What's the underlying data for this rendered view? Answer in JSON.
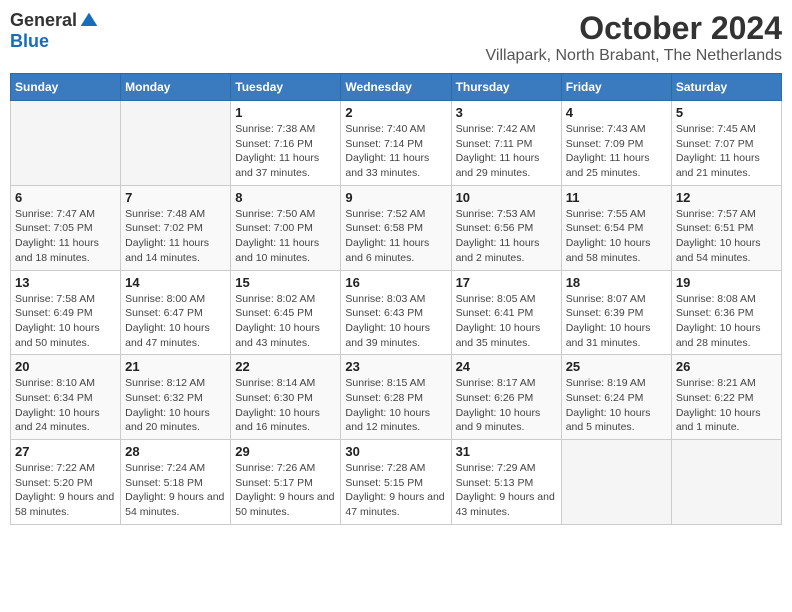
{
  "header": {
    "logo_general": "General",
    "logo_blue": "Blue",
    "month_title": "October 2024",
    "location": "Villapark, North Brabant, The Netherlands"
  },
  "days_of_week": [
    "Sunday",
    "Monday",
    "Tuesday",
    "Wednesday",
    "Thursday",
    "Friday",
    "Saturday"
  ],
  "weeks": [
    [
      {
        "day": "",
        "info": ""
      },
      {
        "day": "",
        "info": ""
      },
      {
        "day": "1",
        "info": "Sunrise: 7:38 AM\nSunset: 7:16 PM\nDaylight: 11 hours and 37 minutes."
      },
      {
        "day": "2",
        "info": "Sunrise: 7:40 AM\nSunset: 7:14 PM\nDaylight: 11 hours and 33 minutes."
      },
      {
        "day": "3",
        "info": "Sunrise: 7:42 AM\nSunset: 7:11 PM\nDaylight: 11 hours and 29 minutes."
      },
      {
        "day": "4",
        "info": "Sunrise: 7:43 AM\nSunset: 7:09 PM\nDaylight: 11 hours and 25 minutes."
      },
      {
        "day": "5",
        "info": "Sunrise: 7:45 AM\nSunset: 7:07 PM\nDaylight: 11 hours and 21 minutes."
      }
    ],
    [
      {
        "day": "6",
        "info": "Sunrise: 7:47 AM\nSunset: 7:05 PM\nDaylight: 11 hours and 18 minutes."
      },
      {
        "day": "7",
        "info": "Sunrise: 7:48 AM\nSunset: 7:02 PM\nDaylight: 11 hours and 14 minutes."
      },
      {
        "day": "8",
        "info": "Sunrise: 7:50 AM\nSunset: 7:00 PM\nDaylight: 11 hours and 10 minutes."
      },
      {
        "day": "9",
        "info": "Sunrise: 7:52 AM\nSunset: 6:58 PM\nDaylight: 11 hours and 6 minutes."
      },
      {
        "day": "10",
        "info": "Sunrise: 7:53 AM\nSunset: 6:56 PM\nDaylight: 11 hours and 2 minutes."
      },
      {
        "day": "11",
        "info": "Sunrise: 7:55 AM\nSunset: 6:54 PM\nDaylight: 10 hours and 58 minutes."
      },
      {
        "day": "12",
        "info": "Sunrise: 7:57 AM\nSunset: 6:51 PM\nDaylight: 10 hours and 54 minutes."
      }
    ],
    [
      {
        "day": "13",
        "info": "Sunrise: 7:58 AM\nSunset: 6:49 PM\nDaylight: 10 hours and 50 minutes."
      },
      {
        "day": "14",
        "info": "Sunrise: 8:00 AM\nSunset: 6:47 PM\nDaylight: 10 hours and 47 minutes."
      },
      {
        "day": "15",
        "info": "Sunrise: 8:02 AM\nSunset: 6:45 PM\nDaylight: 10 hours and 43 minutes."
      },
      {
        "day": "16",
        "info": "Sunrise: 8:03 AM\nSunset: 6:43 PM\nDaylight: 10 hours and 39 minutes."
      },
      {
        "day": "17",
        "info": "Sunrise: 8:05 AM\nSunset: 6:41 PM\nDaylight: 10 hours and 35 minutes."
      },
      {
        "day": "18",
        "info": "Sunrise: 8:07 AM\nSunset: 6:39 PM\nDaylight: 10 hours and 31 minutes."
      },
      {
        "day": "19",
        "info": "Sunrise: 8:08 AM\nSunset: 6:36 PM\nDaylight: 10 hours and 28 minutes."
      }
    ],
    [
      {
        "day": "20",
        "info": "Sunrise: 8:10 AM\nSunset: 6:34 PM\nDaylight: 10 hours and 24 minutes."
      },
      {
        "day": "21",
        "info": "Sunrise: 8:12 AM\nSunset: 6:32 PM\nDaylight: 10 hours and 20 minutes."
      },
      {
        "day": "22",
        "info": "Sunrise: 8:14 AM\nSunset: 6:30 PM\nDaylight: 10 hours and 16 minutes."
      },
      {
        "day": "23",
        "info": "Sunrise: 8:15 AM\nSunset: 6:28 PM\nDaylight: 10 hours and 12 minutes."
      },
      {
        "day": "24",
        "info": "Sunrise: 8:17 AM\nSunset: 6:26 PM\nDaylight: 10 hours and 9 minutes."
      },
      {
        "day": "25",
        "info": "Sunrise: 8:19 AM\nSunset: 6:24 PM\nDaylight: 10 hours and 5 minutes."
      },
      {
        "day": "26",
        "info": "Sunrise: 8:21 AM\nSunset: 6:22 PM\nDaylight: 10 hours and 1 minute."
      }
    ],
    [
      {
        "day": "27",
        "info": "Sunrise: 7:22 AM\nSunset: 5:20 PM\nDaylight: 9 hours and 58 minutes."
      },
      {
        "day": "28",
        "info": "Sunrise: 7:24 AM\nSunset: 5:18 PM\nDaylight: 9 hours and 54 minutes."
      },
      {
        "day": "29",
        "info": "Sunrise: 7:26 AM\nSunset: 5:17 PM\nDaylight: 9 hours and 50 minutes."
      },
      {
        "day": "30",
        "info": "Sunrise: 7:28 AM\nSunset: 5:15 PM\nDaylight: 9 hours and 47 minutes."
      },
      {
        "day": "31",
        "info": "Sunrise: 7:29 AM\nSunset: 5:13 PM\nDaylight: 9 hours and 43 minutes."
      },
      {
        "day": "",
        "info": ""
      },
      {
        "day": "",
        "info": ""
      }
    ]
  ]
}
